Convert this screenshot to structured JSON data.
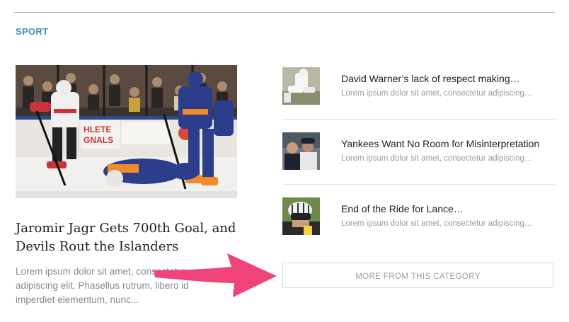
{
  "section": {
    "heading": "SPORT"
  },
  "featured": {
    "image_alt": "Hockey players from the Devils and Islanders on the ice",
    "title": "Jaromir Jagr Gets 700th Goal, and Devils Rout the Islanders",
    "excerpt": "Lorem ipsum dolor sit amet, consectetur adipiscing elit. Phasellus rutrum, libero id imperdiet elementum, nunc...",
    "board_text": "HLETE\nGNALS"
  },
  "stories": [
    {
      "title": "David Warner’s lack of respect making…",
      "excerpt": "Lorem ipsum dolor sit amet, consectetur adipiscing…",
      "thumb": "cricket-player"
    },
    {
      "title": "Yankees Want No Room for Misinterpretation",
      "excerpt": "Lorem ipsum dolor sit amet, consectetur adipiscing…",
      "thumb": "baseball-players"
    },
    {
      "title": "End of the Ride for Lance…",
      "excerpt": "Lorem ipsum dolor sit amet, consectetur adipiscing…",
      "thumb": "cyclist-helmet"
    }
  ],
  "more_button": {
    "label": "MORE FROM THIS CATEGORY"
  },
  "colors": {
    "accent": "#3d8fc0",
    "arrow": "#f0437a"
  }
}
